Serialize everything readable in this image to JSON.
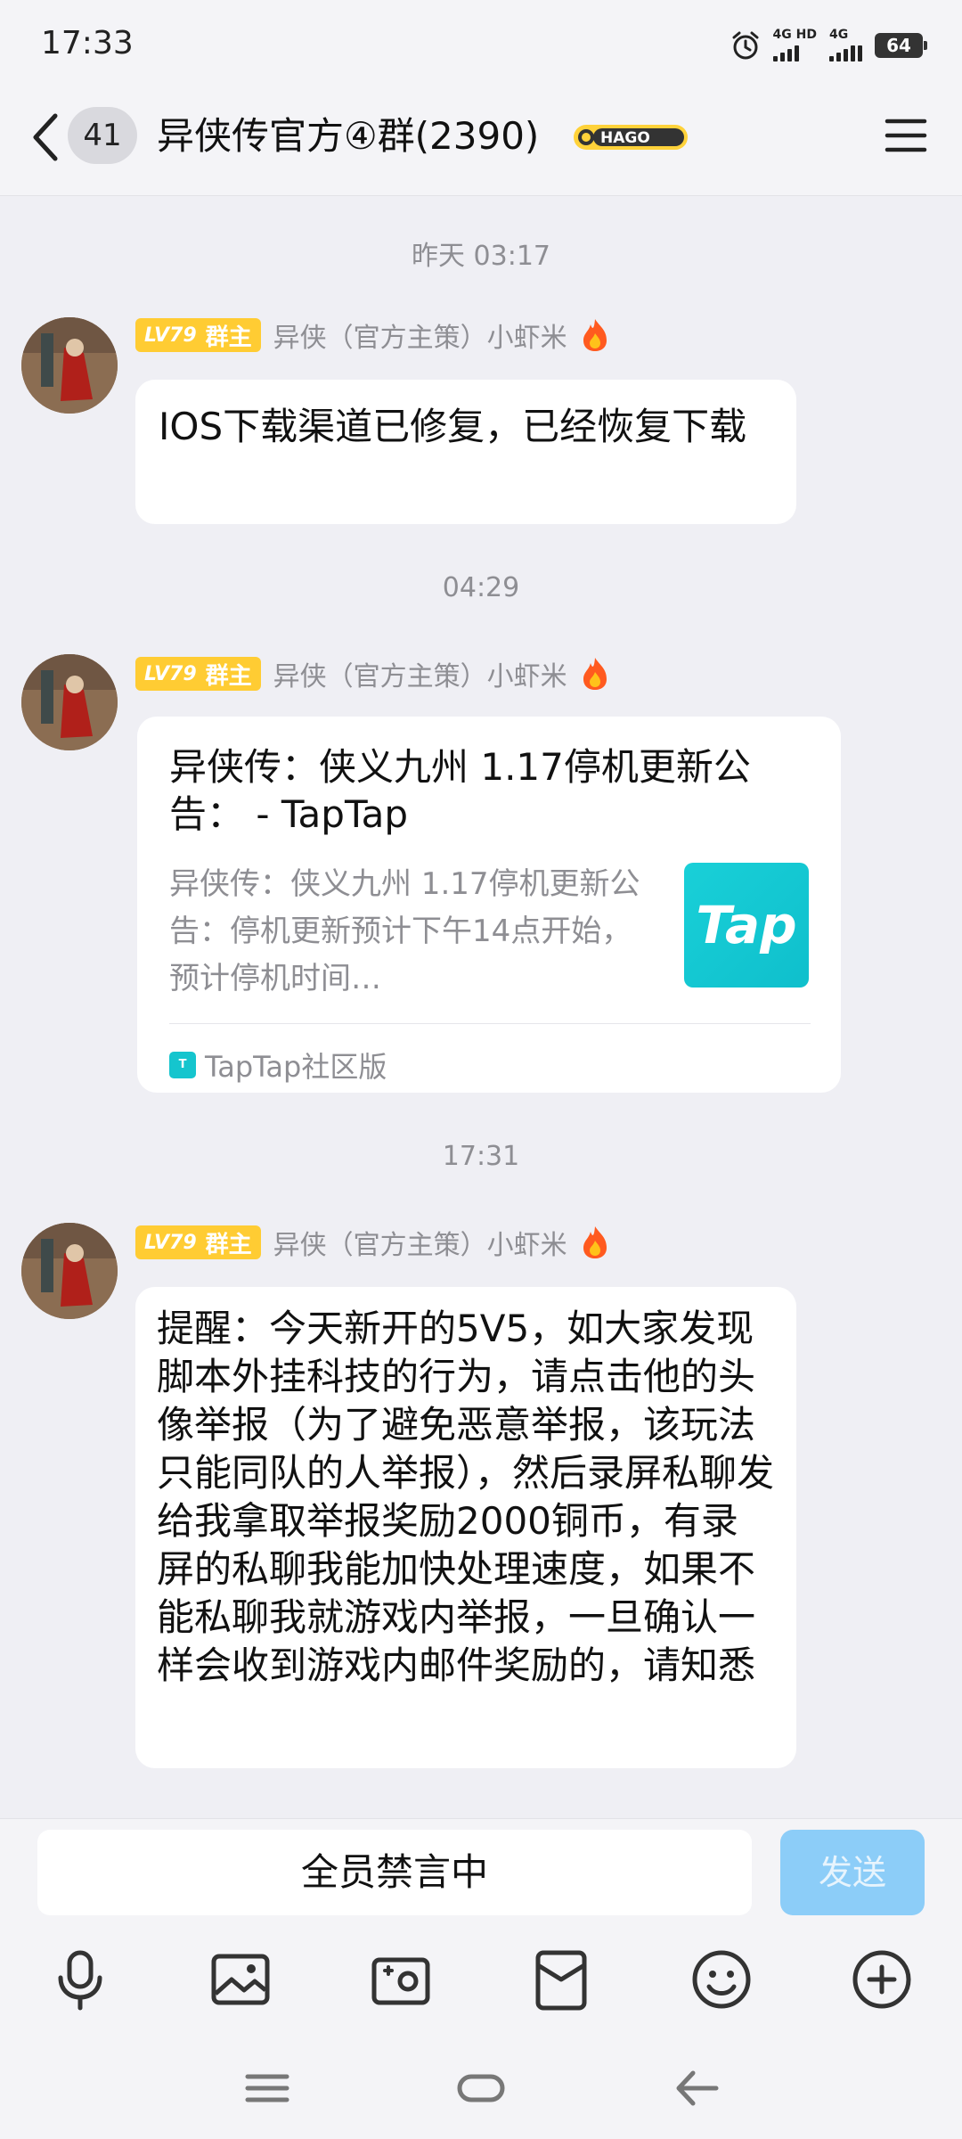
{
  "status": {
    "time": "17:33",
    "network1": "4G HD",
    "network2": "4G",
    "battery": "64"
  },
  "header": {
    "unread_count": "41",
    "title": "异侠传官方④群(2390)",
    "badge_name": "HAGO"
  },
  "messages": [
    {
      "timestamp": "昨天 03:17",
      "level": "LV79",
      "role": "群主",
      "sender": "异侠（官方主策）小虾米",
      "text": "IOS下载渠道已修复，已经恢复下载"
    },
    {
      "timestamp": "04:29",
      "level": "LV79",
      "role": "群主",
      "sender": "异侠（官方主策）小虾米",
      "card": {
        "title": "异侠传：侠义九州 1.17停机更新公告： - TapTap",
        "description": "异侠传：侠义九州 1.17停机更新公告：停机更新预计下午14点开始，预计停机时间…",
        "logo_text": "Tap",
        "source": "TapTap社区版"
      }
    },
    {
      "timestamp": "17:31",
      "level": "LV79",
      "role": "群主",
      "sender": "异侠（官方主策）小虾米",
      "text": "提醒：今天新开的5V5，如大家发现脚本外挂科技的行为，请点击他的头像举报（为了避免恶意举报，该玩法只能同队的人举报），然后录屏私聊发给我拿取举报奖励2000铜币，有录屏的私聊我能加快处理速度，如果不能私聊我就游戏内举报，一旦确认一样会收到游戏内邮件奖励的，请知悉"
    }
  ],
  "input": {
    "muted_label": "全员禁言中",
    "send_label": "发送"
  },
  "toolbar_icons": [
    "microphone-icon",
    "image-icon",
    "camera-icon",
    "red-packet-icon",
    "emoji-icon",
    "plus-icon"
  ],
  "colors": {
    "badge": "#ffcc33",
    "send_disabled": "#8ccdf8",
    "tap_brand": "#15c5ce",
    "background": "#efeff4"
  }
}
